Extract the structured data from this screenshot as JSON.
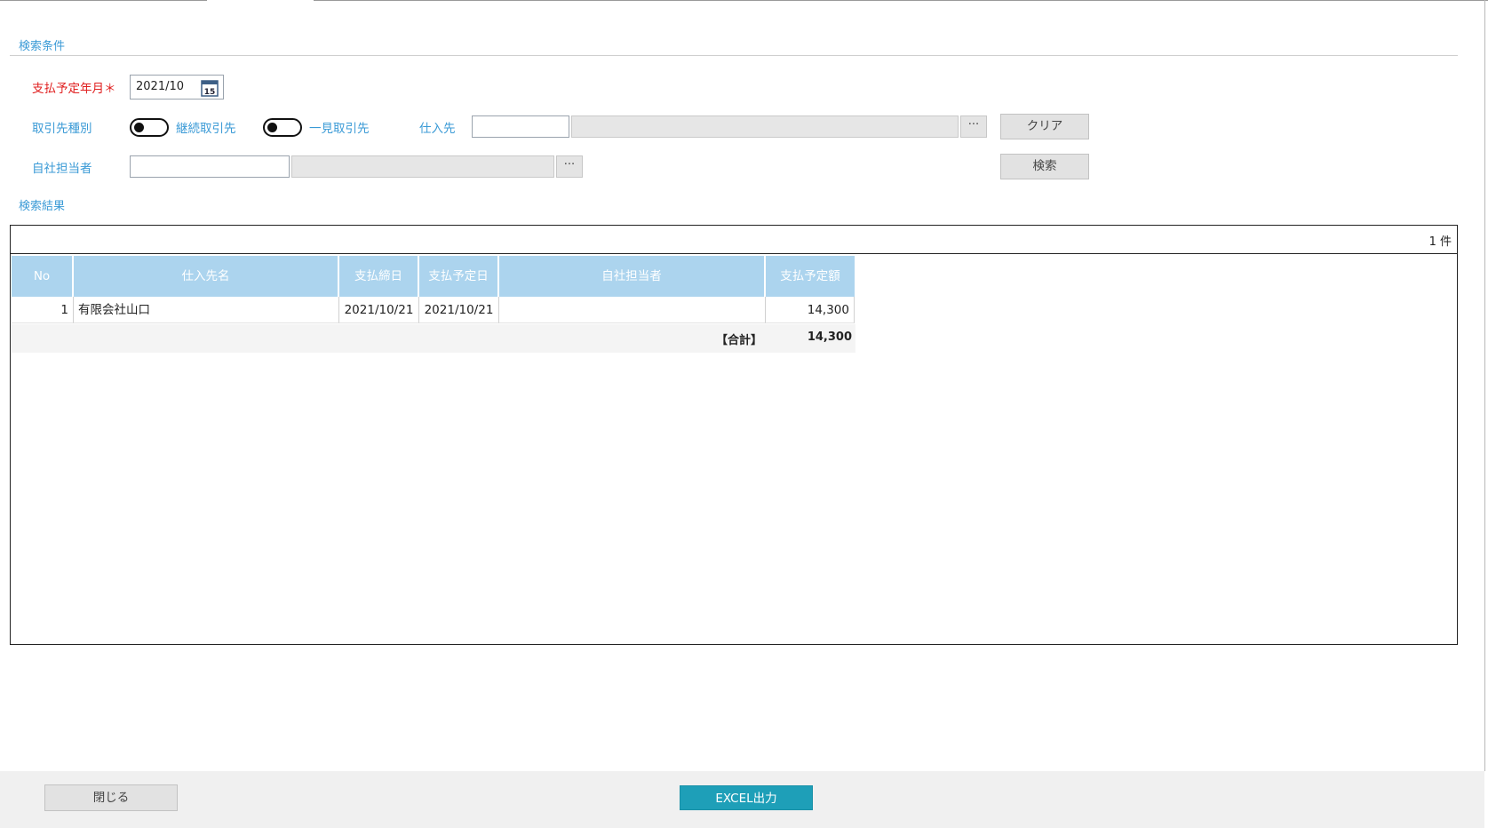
{
  "search": {
    "section_title": "検索条件",
    "pay_month_label": "支払予定年月＊",
    "pay_month_value": "2021/10",
    "calendar_icon_text": "15",
    "partner_type_label": "取引先種別",
    "partner_type_options": [
      "継続取引先",
      "一見取引先"
    ],
    "supplier_label": "仕入先",
    "supplier_code": "",
    "supplier_name": "",
    "lookup_dots": "···",
    "staff_label": "自社担当者",
    "staff_code": "",
    "staff_name": "",
    "clear_label": "クリア",
    "search_label": "検索"
  },
  "results": {
    "section_title": "検索結果",
    "count_text": "1 件",
    "columns": [
      "No",
      "仕入先名",
      "支払締日",
      "支払予定日",
      "自社担当者",
      "支払予定額"
    ],
    "rows": [
      {
        "no": "1",
        "supplier": "有限会社山口",
        "closing_date": "2021/10/21",
        "pay_date": "2021/10/21",
        "staff": "",
        "amount": "14,300"
      }
    ],
    "total_label": "【合計】",
    "total_amount": "14,300"
  },
  "footer": {
    "close_label": "閉じる",
    "excel_label": "EXCEL出力"
  },
  "colors": {
    "accent": "#3a9ad6",
    "required": "#e02020",
    "header_bg": "#acd4ee",
    "excel_btn": "#1e9fb8"
  }
}
